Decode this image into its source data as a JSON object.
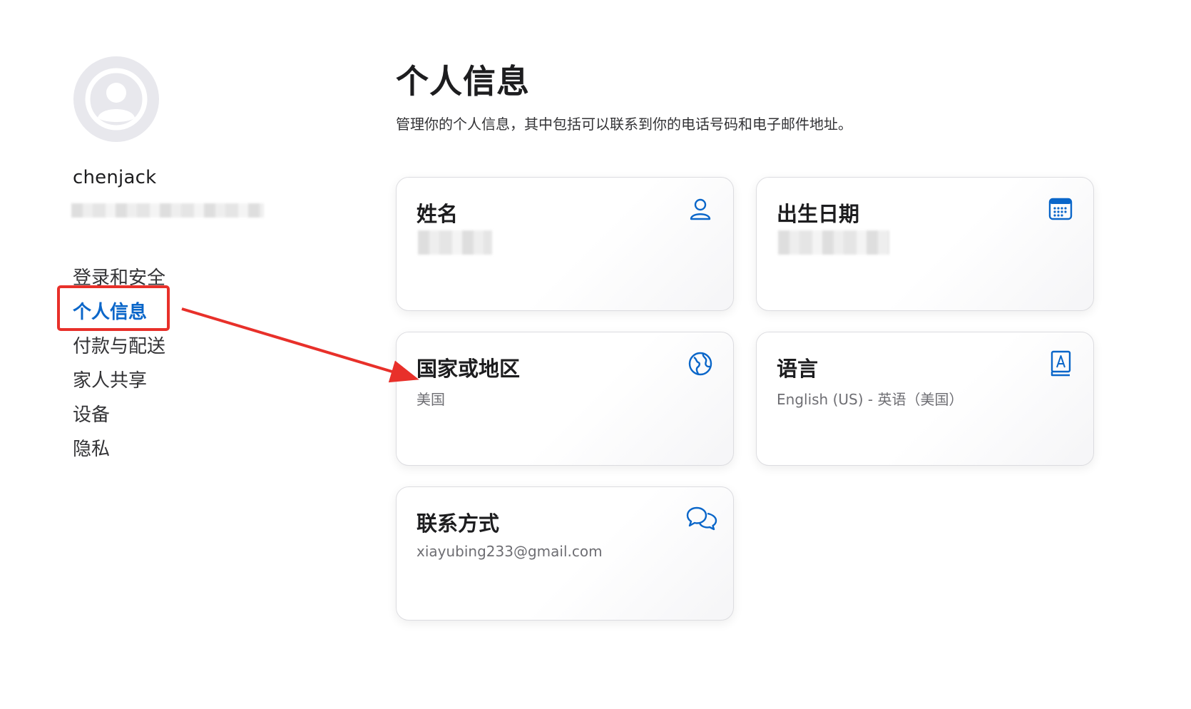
{
  "sidebar": {
    "username": "chenjack",
    "nav": [
      {
        "label": "登录和安全"
      },
      {
        "label": "个人信息",
        "active": true
      },
      {
        "label": "付款与配送"
      },
      {
        "label": "家人共享"
      },
      {
        "label": "设备"
      },
      {
        "label": "隐私"
      }
    ]
  },
  "main": {
    "title": "个人信息",
    "subtitle": "管理你的个人信息，其中包括可以联系到你的电话号码和电子邮件地址。",
    "cards": {
      "name": {
        "title": "姓名",
        "icon": "person-icon"
      },
      "birthday": {
        "title": "出生日期",
        "icon": "calendar-icon"
      },
      "region": {
        "title": "国家或地区",
        "value": "美国",
        "icon": "globe-icon"
      },
      "language": {
        "title": "语言",
        "value": "English (US) - 英语（美国）",
        "icon": "book-icon"
      },
      "contact": {
        "title": "联系方式",
        "value": "xiayubing233@gmail.com",
        "icon": "chat-bubbles-icon"
      }
    }
  },
  "colors": {
    "accent": "#0a66c9",
    "annotation": "#e8302a",
    "avatar_bg": "#e8e8ed"
  }
}
